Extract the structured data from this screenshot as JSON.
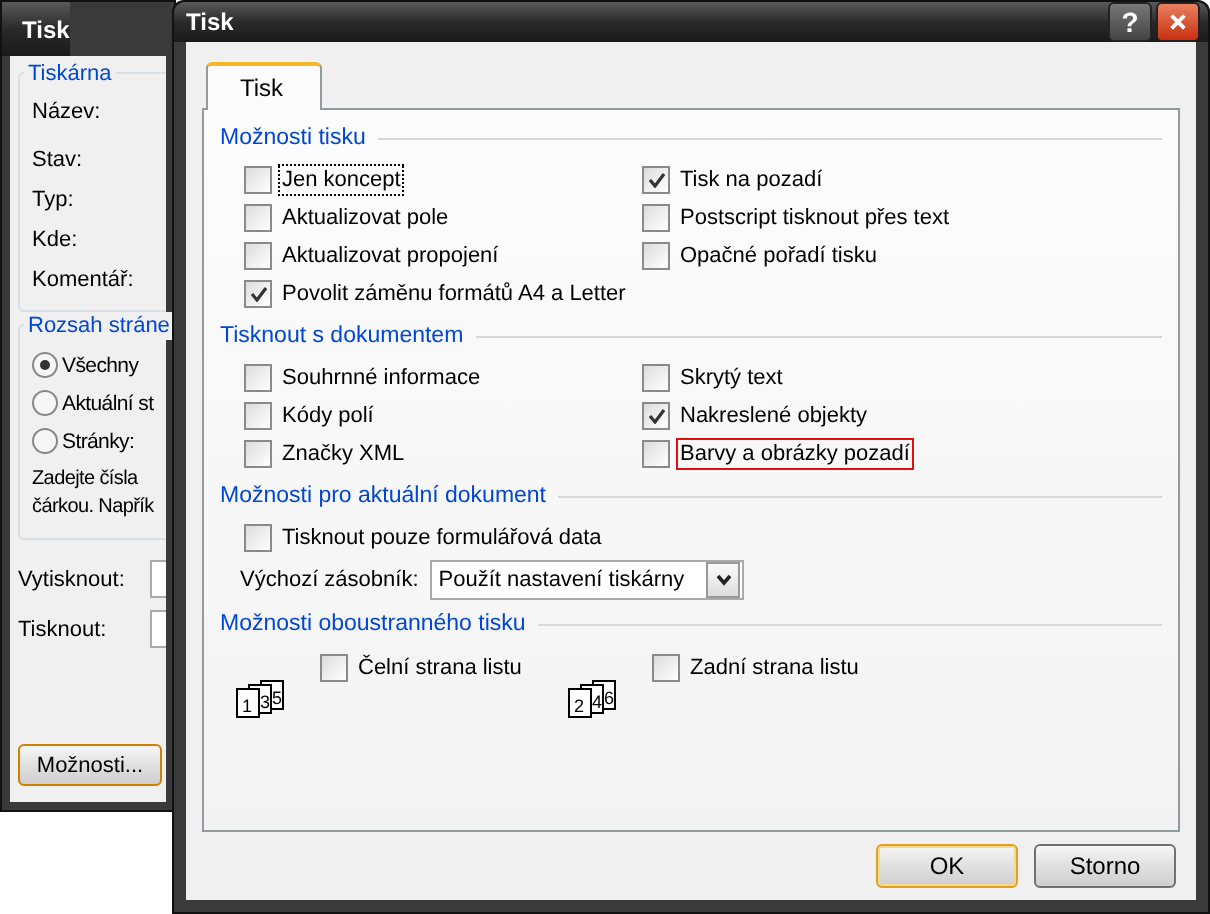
{
  "back_window": {
    "title": "Tisk",
    "printer_group": {
      "title": "Tiskárna",
      "labels": [
        "Název:",
        "Stav:",
        "Typ:",
        "Kde:",
        "Komentář:"
      ]
    },
    "range_group": {
      "title": "Rozsah stráne",
      "options": [
        {
          "label": "Všechny",
          "selected": true
        },
        {
          "label": "Aktuální st",
          "selected": false
        },
        {
          "label": "Stránky:",
          "selected": false
        }
      ],
      "hint_lines": [
        "Zadejte čísla",
        "čárkou. Napřík"
      ]
    },
    "fields": [
      {
        "label": "Vytisknout:"
      },
      {
        "label": "Tisknout:"
      }
    ],
    "options_button": "Možnosti..."
  },
  "dialog": {
    "title": "Tisk",
    "help_button": "?",
    "tabs": [
      {
        "label": "Tisk",
        "selected": true
      }
    ],
    "sections": [
      {
        "title": "Možnosti tisku",
        "kind": "checks",
        "columns": [
          [
            {
              "label": "Jen koncept",
              "checked": false,
              "focused": true,
              "highlighted": false
            },
            {
              "label": "Aktualizovat pole",
              "checked": false,
              "focused": false,
              "highlighted": false
            },
            {
              "label": "Aktualizovat propojení",
              "checked": false,
              "focused": false,
              "highlighted": false
            },
            {
              "label": "Povolit záměnu formátů A4 a Letter",
              "checked": true,
              "focused": false,
              "highlighted": false
            }
          ],
          [
            {
              "label": "Tisk na pozadí",
              "checked": true,
              "focused": false,
              "highlighted": false
            },
            {
              "label": "Postscript tisknout přes text",
              "checked": false,
              "focused": false,
              "highlighted": false
            },
            {
              "label": "Opačné pořadí tisku",
              "checked": false,
              "focused": false,
              "highlighted": false
            }
          ]
        ]
      },
      {
        "title": "Tisknout s dokumentem",
        "kind": "checks",
        "columns": [
          [
            {
              "label": "Souhrnné informace",
              "checked": false,
              "focused": false,
              "highlighted": false
            },
            {
              "label": "Kódy polí",
              "checked": false,
              "focused": false,
              "highlighted": false
            },
            {
              "label": "Značky XML",
              "checked": false,
              "focused": false,
              "highlighted": false
            }
          ],
          [
            {
              "label": "Skrytý text",
              "checked": false,
              "focused": false,
              "highlighted": false
            },
            {
              "label": "Nakreslené objekty",
              "checked": true,
              "focused": false,
              "highlighted": false
            },
            {
              "label": "Barvy a obrázky pozadí",
              "checked": false,
              "focused": false,
              "highlighted": true
            }
          ]
        ]
      },
      {
        "title": "Možnosti pro aktuální dokument",
        "kind": "form",
        "check": {
          "label": "Tisknout pouze formulářová data",
          "checked": false
        },
        "select": {
          "label": "Výchozí zásobník:",
          "value": "Použít nastavení tiskárny"
        }
      },
      {
        "title": "Možnosti oboustranného tisku",
        "kind": "duplex",
        "items": [
          {
            "label": "Čelní strana listu",
            "checked": false,
            "pages": [
              "1",
              "3",
              "5"
            ]
          },
          {
            "label": "Zadní strana listu",
            "checked": false,
            "pages": [
              "2",
              "4",
              "6"
            ]
          }
        ]
      }
    ],
    "buttons": [
      {
        "label": "OK",
        "default": true
      },
      {
        "label": "Storno",
        "default": false
      }
    ]
  }
}
